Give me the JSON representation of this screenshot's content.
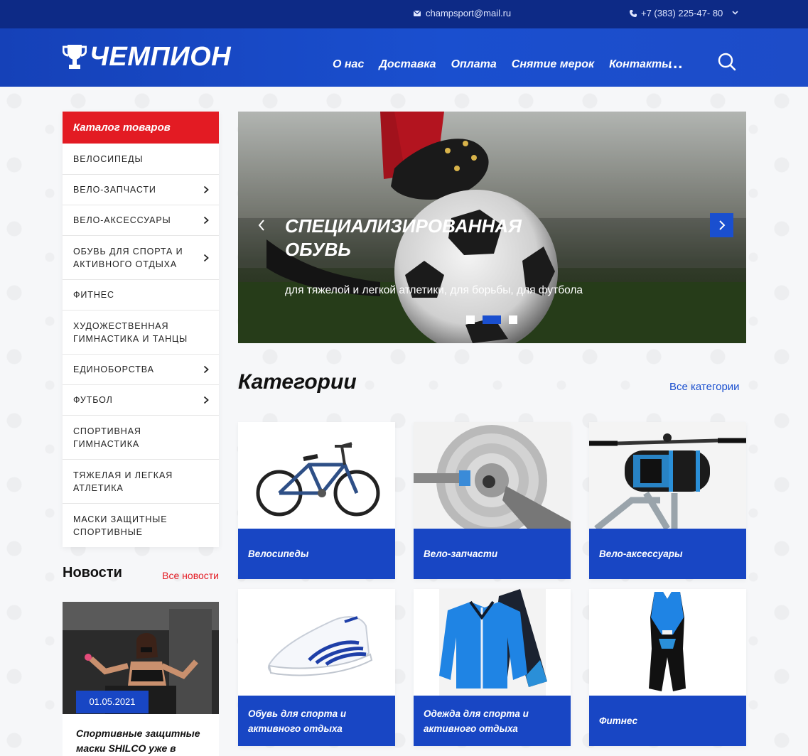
{
  "topbar": {
    "email": "champsport@mail.ru",
    "phone": "+7 (383) 225-47- 80"
  },
  "header": {
    "logo": "ЧЕМПИОН",
    "nav": [
      "О нас",
      "Доставка",
      "Оплата",
      "Снятие мерок",
      "Контакты"
    ],
    "more": "..."
  },
  "catalog": {
    "title": "Каталог товаров",
    "items": [
      {
        "label": "ВЕЛОСИПЕДЫ",
        "has_sub": false
      },
      {
        "label": "ВЕЛО-ЗАПЧАСТИ",
        "has_sub": true
      },
      {
        "label": "ВЕЛО-АКСЕССУАРЫ",
        "has_sub": true
      },
      {
        "label": "ОБУВЬ ДЛЯ СПОРТА И АКТИВНОГО ОТДЫХА",
        "has_sub": true
      },
      {
        "label": "ФИТНЕС",
        "has_sub": false
      },
      {
        "label": "ХУДОЖЕСТВЕННАЯ ГИМНАСТИКА И ТАНЦЫ",
        "has_sub": false
      },
      {
        "label": "ЕДИНОБОРСТВА",
        "has_sub": true
      },
      {
        "label": "ФУТБОЛ",
        "has_sub": true
      },
      {
        "label": "СПОРТИВНАЯ ГИМНАСТИКА",
        "has_sub": false
      },
      {
        "label": "ТЯЖЕЛАЯ И ЛЕГКАЯ АТЛЕТИКА",
        "has_sub": false
      },
      {
        "label": "МАСКИ ЗАЩИТНЫЕ СПОРТИВНЫЕ",
        "has_sub": false
      }
    ]
  },
  "news": {
    "title": "Новости",
    "all_label": "Все новости",
    "item": {
      "date": "01.05.2021",
      "text": "Спортивные защитные маски SHILCO уже в"
    }
  },
  "slider": {
    "heading": "Специализированная обувь",
    "subtitle": "для тяжелой и легкой атлетики, для борьбы, для футбола",
    "active_index": 1,
    "count": 3
  },
  "categories": {
    "title": "Категории",
    "all_label": "Все категории",
    "items": [
      {
        "label": "Велосипеды",
        "icon": "bicycle-image"
      },
      {
        "label": "Вело-запчасти",
        "icon": "cassette-image"
      },
      {
        "label": "Вело-аксессуары",
        "icon": "bike-bag-image"
      },
      {
        "label": "Обувь для спорта и активного отдыха",
        "icon": "sneaker-image"
      },
      {
        "label": "Одежда для спорта и активного отдыха",
        "icon": "tracksuit-image"
      },
      {
        "label": "Фитнес",
        "icon": "trisuit-image"
      }
    ]
  },
  "colors": {
    "brand_blue": "#1846c4",
    "topbar_blue": "#0d2a86",
    "accent_red": "#e31b23"
  }
}
